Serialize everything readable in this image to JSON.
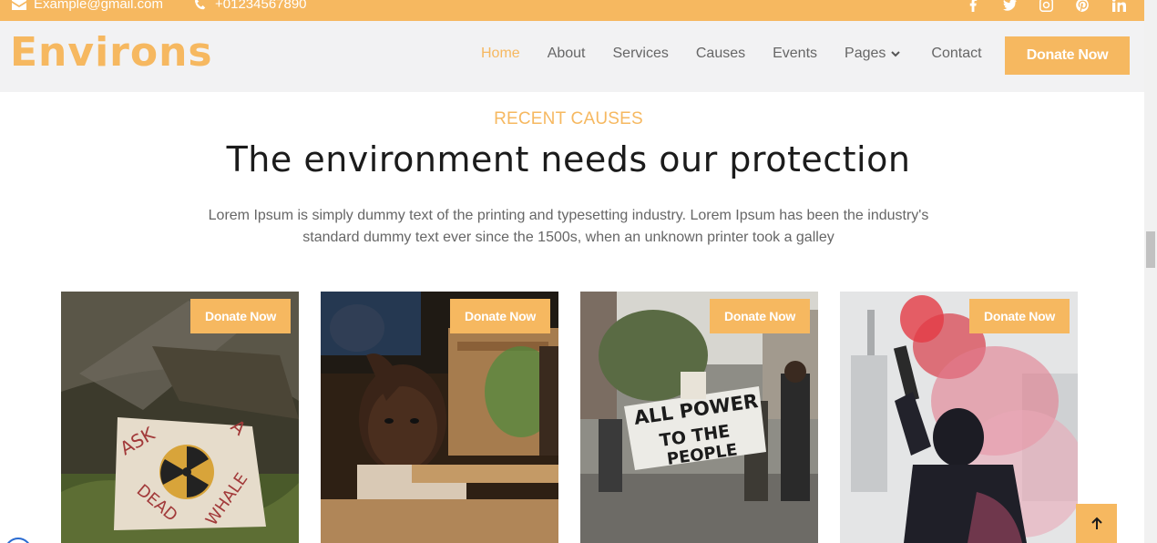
{
  "topbar": {
    "email": "Example@gmail.com",
    "phone": "+01234567890",
    "social_icons": [
      "facebook-icon",
      "twitter-icon",
      "instagram-icon",
      "pinterest-icon",
      "linkedin-icon"
    ]
  },
  "header": {
    "logo": "Environs",
    "nav": [
      {
        "label": "Home",
        "active": true
      },
      {
        "label": "About"
      },
      {
        "label": "Services"
      },
      {
        "label": "Causes"
      },
      {
        "label": "Events"
      },
      {
        "label": "Pages"
      },
      {
        "label": "Contact"
      }
    ],
    "donate_label": "Donate Now"
  },
  "section": {
    "eyebrow": "RECENT CAUSES",
    "heading": "The environment needs our protection",
    "description": "Lorem Ipsum is simply dummy text of the printing and typesetting industry. Lorem Ipsum has been the industry's standard dummy text ever since the 1500s, when an unknown printer took a galley"
  },
  "cards": [
    {
      "button": "Donate Now",
      "image_sign_text": "ASK A DEAD WHALE"
    },
    {
      "button": "Donate Now"
    },
    {
      "button": "Donate Now",
      "image_sign_text": "ALL POWER TO THE PEOPLE"
    },
    {
      "button": "Donate Now"
    }
  ],
  "colors": {
    "accent": "#f6b860",
    "header_bg": "#f2f2f3",
    "text": "#1b1b1b",
    "muted": "#666666"
  }
}
